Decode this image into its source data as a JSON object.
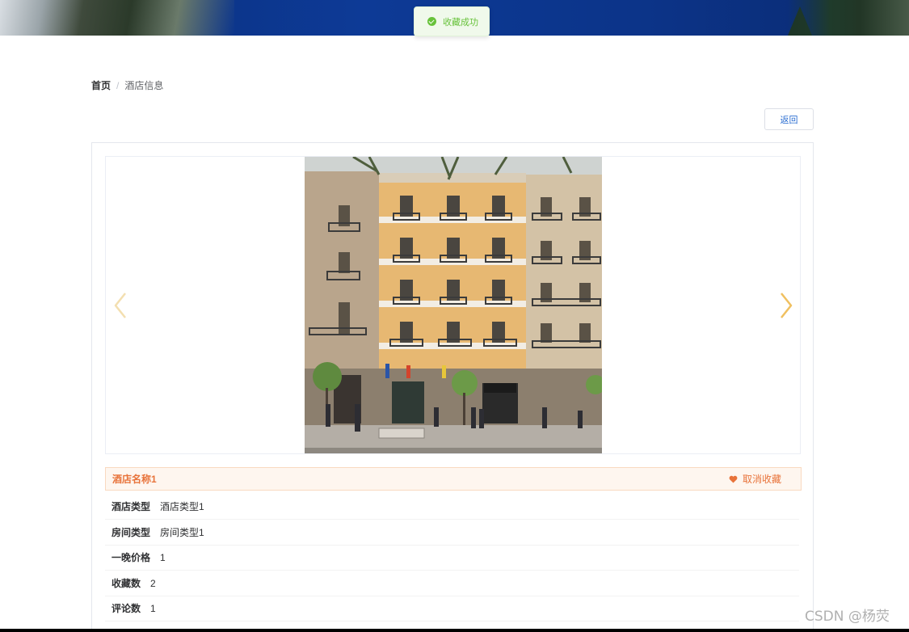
{
  "toast": {
    "message": "收藏成功",
    "icon": "check-circle-icon",
    "color": "#67c23a"
  },
  "breadcrumb": {
    "home": "首页",
    "separator": "/",
    "current": "酒店信息"
  },
  "back_button": {
    "label": "返回"
  },
  "carousel": {
    "prev_icon": "chevron-left-icon",
    "next_icon": "chevron-right-icon",
    "arrow_color": "#f0c060"
  },
  "hotel": {
    "name": "酒店名称1",
    "favorite_label": "取消收藏",
    "favorite_icon": "heart-icon",
    "accent_color": "#e8733a",
    "details": [
      {
        "label": "酒店类型",
        "value": "酒店类型1"
      },
      {
        "label": "房间类型",
        "value": "房间类型1"
      },
      {
        "label": "一晚价格",
        "value": "1"
      },
      {
        "label": "收藏数",
        "value": "2"
      },
      {
        "label": "评论数",
        "value": "1"
      }
    ]
  },
  "watermark": "CSDN @杨荧"
}
